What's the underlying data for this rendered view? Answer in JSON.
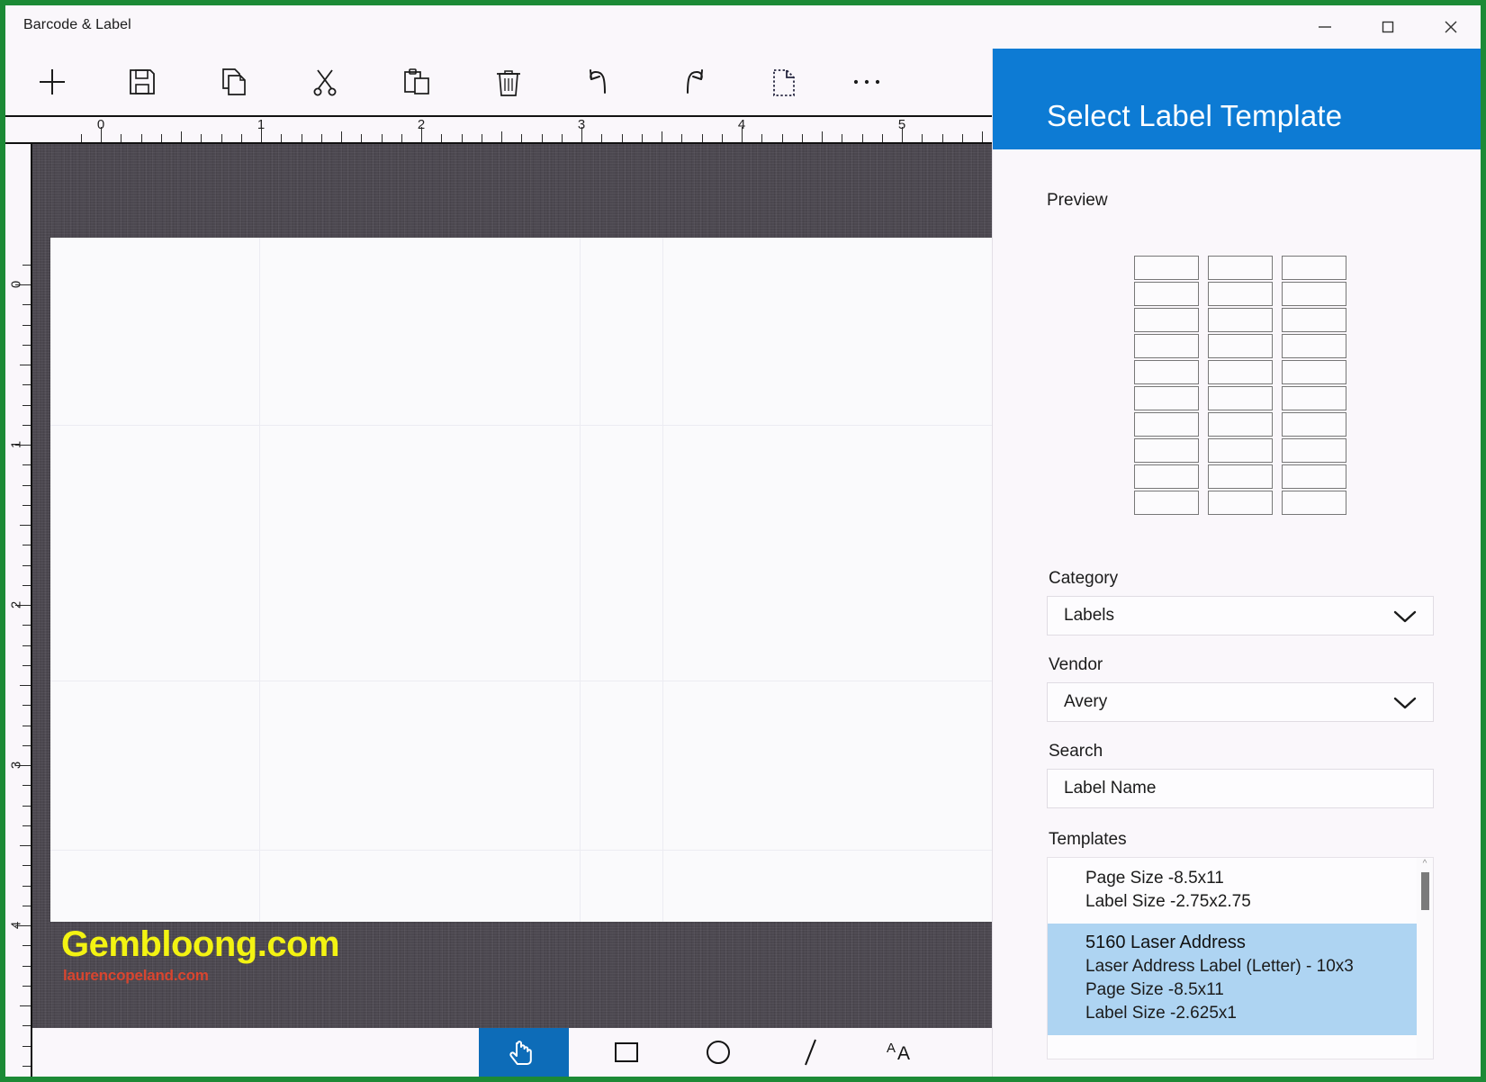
{
  "window": {
    "title": "Barcode & Label",
    "controls": [
      {
        "name": "minimize",
        "glyph": "—"
      },
      {
        "name": "maximize",
        "glyph": "☐"
      },
      {
        "name": "close",
        "glyph": "✕"
      }
    ]
  },
  "toolbar": {
    "items": [
      {
        "name": "new",
        "label": "New",
        "icon": "plus-icon"
      },
      {
        "name": "save",
        "label": "Save",
        "icon": "save-icon"
      },
      {
        "name": "copy",
        "label": "Copy",
        "icon": "copy-icon"
      },
      {
        "name": "cut",
        "label": "Cut",
        "icon": "scissors-icon"
      },
      {
        "name": "paste",
        "label": "Paste",
        "icon": "clipboard-icon"
      },
      {
        "name": "delete",
        "label": "Delete",
        "icon": "trash-icon"
      },
      {
        "name": "undo",
        "label": "Undo",
        "icon": "undo-icon"
      },
      {
        "name": "redo",
        "label": "Redo",
        "icon": "redo-icon"
      },
      {
        "name": "select-page",
        "label": "Select Page",
        "icon": "dashed-page-icon"
      },
      {
        "name": "more",
        "label": "More",
        "icon": "ellipsis-icon"
      }
    ]
  },
  "rulers": {
    "horizontal": {
      "labels": [
        "0",
        "1",
        "2",
        "3",
        "4",
        "5"
      ],
      "unit": "inch"
    },
    "vertical": {
      "labels": [
        "0",
        "1",
        "2",
        "3",
        "4"
      ],
      "unit": "inch"
    }
  },
  "canvas": {
    "watermark_primary": "Gembloong.com",
    "watermark_secondary": "laurencopeland.com"
  },
  "bottom_tools": {
    "items": [
      {
        "name": "select-tool",
        "label": "Select",
        "icon": "hand-pointer-icon",
        "active": true
      },
      {
        "name": "rectangle-tool",
        "label": "Rectangle",
        "icon": "square-icon",
        "active": false
      },
      {
        "name": "ellipse-tool",
        "label": "Ellipse",
        "icon": "circle-icon",
        "active": false
      },
      {
        "name": "line-tool",
        "label": "Line",
        "icon": "slash-icon",
        "active": false
      },
      {
        "name": "text-tool",
        "label": "Text",
        "icon": "text-aa-icon",
        "active": false
      }
    ]
  },
  "panel": {
    "title": "Select Label Template",
    "header_color": "#0d7bd4",
    "preview_label": "Preview",
    "preview": {
      "columns": 3,
      "rows": 10
    },
    "category": {
      "label": "Category",
      "value": "Labels"
    },
    "vendor": {
      "label": "Vendor",
      "value": "Avery"
    },
    "search": {
      "label": "Search",
      "value": "",
      "placeholder": "Label Name"
    },
    "templates": {
      "label": "Templates",
      "selected_index": 1,
      "selection_color": "#aed4f2",
      "items": [
        {
          "name": "",
          "lines": [
            "Page Size -8.5x11",
            "Label Size -2.75x2.75"
          ],
          "selected": false
        },
        {
          "name": "5160 Laser Address",
          "lines": [
            "Laser Address Label (Letter) - 10x3",
            "Page Size -8.5x11",
            "Label Size -2.625x1"
          ],
          "selected": true
        }
      ]
    }
  }
}
